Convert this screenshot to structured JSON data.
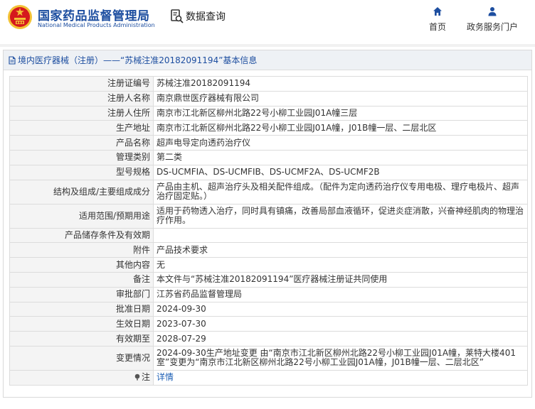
{
  "header": {
    "brand_cn": "国家药品监督管理局",
    "brand_en": "National Medical Products Administration",
    "search_label": "数据查询",
    "nav": {
      "home": "首页",
      "services": "政务服务门户"
    }
  },
  "colors": {
    "brand": "#1d4ea0",
    "logo_red": "#d5191d",
    "logo_gold": "#f3c236",
    "link": "#1d5fb5"
  },
  "panel": {
    "title": "境内医疗器械（注册）——“苏械注准20182091194”基本信息"
  },
  "rows": [
    {
      "key": "注册证编号",
      "value": "苏械注准20182091194"
    },
    {
      "key": "注册人名称",
      "value": "南京鼎世医疗器械有限公司"
    },
    {
      "key": "注册人住所",
      "value": "南京市江北新区柳州北路22号小柳工业园J01A幢三层"
    },
    {
      "key": "生产地址",
      "value": "南京市江北新区柳州北路22号小柳工业园J01A幢，J01B幢一层、二层北区"
    },
    {
      "key": "产品名称",
      "value": "超声电导定向透药治疗仪"
    },
    {
      "key": "管理类别",
      "value": "第二类"
    },
    {
      "key": "型号规格",
      "value": "DS-UCMFⅠA、DS-UCMFⅠB、DS-UCMF2A、DS-UCMF2B"
    },
    {
      "key": "结构及组成/主要组成成分",
      "value": "产品由主机、超声治疗头及相关配件组成。（配件为定向透药治疗仪专用电极、理疗电极片、超声治疗固定贴。）"
    },
    {
      "key": "适用范围/预期用途",
      "value": "适用于药物透入治疗，同时具有镇痛，改善局部血液循环，促进炎症消散，兴奋神经肌肉的物理治疗作用。"
    },
    {
      "key": "产品储存条件及有效期",
      "value": ""
    },
    {
      "key": "附件",
      "value": "产品技术要求"
    },
    {
      "key": "其他内容",
      "value": "无"
    },
    {
      "key": "备注",
      "value": "本文件与“苏械注准20182091194”医疗器械注册证共同使用"
    },
    {
      "key": "审批部门",
      "value": "江苏省药品监督管理局"
    },
    {
      "key": "批准日期",
      "value": "2024-09-30"
    },
    {
      "key": "生效日期",
      "value": "2023-07-30"
    },
    {
      "key": "有效期至",
      "value": "2028-07-29"
    },
    {
      "key": "变更情况",
      "value": "2024-09-30生产地址变更 由“南京市江北新区柳州北路22号小柳工业园J01A幢，莱特大楼401室”变更为“南京市江北新区柳州北路22号小柳工业园J01A幢，J01B幢一层、二层北区”"
    }
  ],
  "note": {
    "key": "注",
    "link_label": "详情",
    "icon": "info-icon"
  }
}
